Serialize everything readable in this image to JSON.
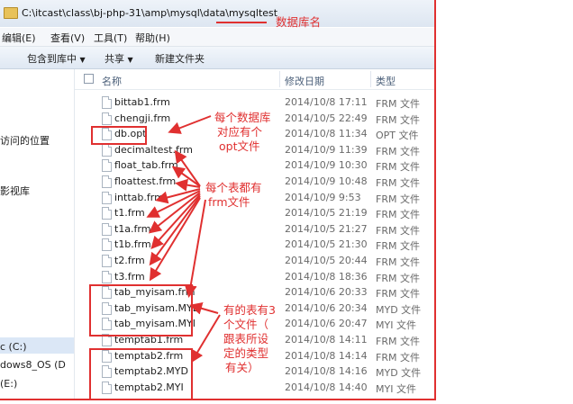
{
  "address": {
    "path": "C:\\itcast\\class\\bj-php-31\\amp\\mysql\\data\\mysqltest"
  },
  "menu": [
    "编辑(E)",
    "查看(V)",
    "工具(T)",
    "帮助(H)"
  ],
  "toolbar": {
    "include": "包含到库中",
    "share": "共享",
    "new_folder": "新建文件夹"
  },
  "nav": {
    "recent": "访问的位置",
    "video": "影视库",
    "drive_c": "c (C:)",
    "drive_d": "dows8_OS (D",
    "drive_e": "(E:)"
  },
  "columns": {
    "name": "名称",
    "date": "修改日期",
    "type": "类型"
  },
  "files": [
    {
      "name": "bittab1.frm",
      "date": "2014/10/8 17:11",
      "type": "FRM 文件"
    },
    {
      "name": "chengji.frm",
      "date": "2014/10/5 22:49",
      "type": "FRM 文件"
    },
    {
      "name": "db.opt",
      "date": "2014/10/8 11:34",
      "type": "OPT 文件"
    },
    {
      "name": "decimaltest.frm",
      "date": "2014/10/9 11:39",
      "type": "FRM 文件"
    },
    {
      "name": "float_tab.frm",
      "date": "2014/10/9 10:30",
      "type": "FRM 文件"
    },
    {
      "name": "floattest.frm",
      "date": "2014/10/9 10:48",
      "type": "FRM 文件"
    },
    {
      "name": "inttab.frm",
      "date": "2014/10/9 9:53",
      "type": "FRM 文件"
    },
    {
      "name": "t1.frm",
      "date": "2014/10/5 21:19",
      "type": "FRM 文件"
    },
    {
      "name": "t1a.frm",
      "date": "2014/10/5 21:27",
      "type": "FRM 文件"
    },
    {
      "name": "t1b.frm",
      "date": "2014/10/5 21:30",
      "type": "FRM 文件"
    },
    {
      "name": "t2.frm",
      "date": "2014/10/5 20:44",
      "type": "FRM 文件"
    },
    {
      "name": "t3.frm",
      "date": "2014/10/8 18:36",
      "type": "FRM 文件"
    },
    {
      "name": "tab_myisam.frm",
      "date": "2014/10/6 20:33",
      "type": "FRM 文件"
    },
    {
      "name": "tab_myisam.MYD",
      "date": "2014/10/6 20:34",
      "type": "MYD 文件"
    },
    {
      "name": "tab_myisam.MYI",
      "date": "2014/10/6 20:47",
      "type": "MYI 文件"
    },
    {
      "name": "temptab1.frm",
      "date": "2014/10/8 14:11",
      "type": "FRM 文件"
    },
    {
      "name": "temptab2.frm",
      "date": "2014/10/8 14:14",
      "type": "FRM 文件"
    },
    {
      "name": "temptab2.MYD",
      "date": "2014/10/8 14:16",
      "type": "MYD 文件"
    },
    {
      "name": "temptab2.MYI",
      "date": "2014/10/8 14:40",
      "type": "MYI 文件"
    }
  ],
  "annotations": {
    "db_name": "数据库名",
    "opt_note": [
      "每个数据库",
      "对应有个",
      "opt文件"
    ],
    "frm_note": [
      "每个表都有",
      "frm文件"
    ],
    "myisam_note": [
      "有的表有3",
      "个文件（",
      "跟表所设",
      "定的类型",
      "有关）"
    ]
  },
  "colors": {
    "annotation": "#e03030"
  }
}
